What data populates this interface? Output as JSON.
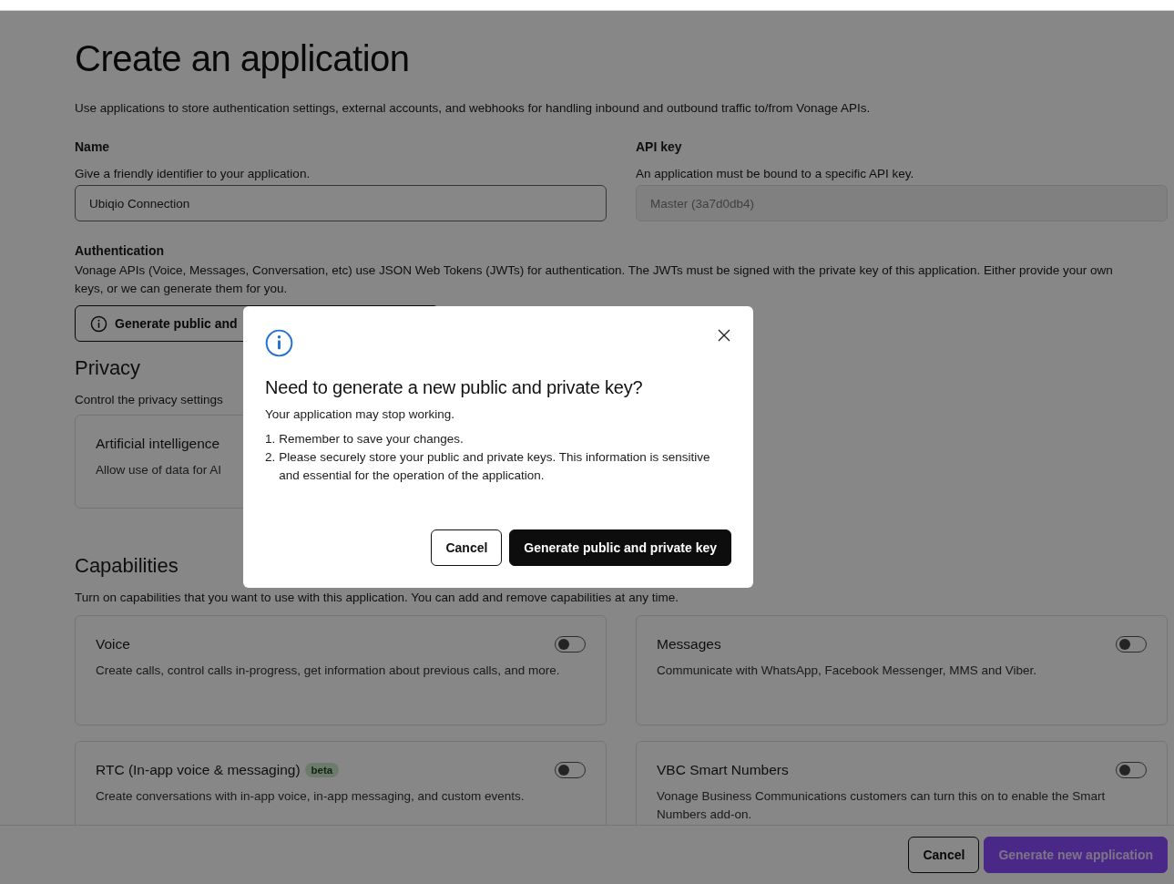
{
  "page": {
    "title": "Create an application",
    "description": "Use applications to store authentication settings, external accounts, and webhooks for handling inbound and outbound traffic to/from Vonage APIs."
  },
  "name_field": {
    "label": "Name",
    "hint": "Give a friendly identifier to your application.",
    "value": "Ubiqio Connection",
    "disabled": false
  },
  "api_key_field": {
    "label": "API key",
    "hint": "An application must be bound to a specific API key.",
    "value": "Master (3a7d0db4)",
    "disabled": true
  },
  "authentication": {
    "label": "Authentication",
    "description": "Vonage APIs (Voice, Messages, Conversation, etc) use JSON Web Tokens (JWTs) for authentication. The JWTs must be signed with the private key of this application. Either provide your own keys, or we can generate them for you.",
    "button": "Generate public and"
  },
  "privacy": {
    "title": "Privacy",
    "description": "Control the privacy settings",
    "card": {
      "title": "Artificial intelligence",
      "description": "Allow use of data for AI"
    }
  },
  "capabilities": {
    "title": "Capabilities",
    "description": "Turn on capabilities that you want to use with this application. You can add and remove capabilities at any time.",
    "items": [
      {
        "title": "Voice",
        "description": "Create calls, control calls in-progress, get information about previous calls, and more.",
        "on": false
      },
      {
        "title": "Messages",
        "description": "Communicate with WhatsApp, Facebook Messenger, MMS and Viber.",
        "on": false
      },
      {
        "title": "RTC (In-app voice & messaging)",
        "badge": "beta",
        "description": "Create conversations with in-app voice, in-app messaging, and custom events.",
        "on": false
      },
      {
        "title": "VBC Smart Numbers",
        "description": "Vonage Business Communications customers can turn this on to enable the Smart Numbers add-on.",
        "on": false
      }
    ]
  },
  "footer": {
    "buttons": [
      {
        "label": "Cancel",
        "kind": "secondary"
      },
      {
        "label": "Generate new application",
        "kind": "primary"
      }
    ]
  },
  "dialog": {
    "title": "Need to generate a new public and private key?",
    "message": "Your application may stop working.",
    "steps": [
      {
        "number": "1.",
        "text": "Remember to save your changes."
      },
      {
        "number": "2.",
        "text": "Please securely store your public and private keys. This information is sensitive and essential for the operation of the application."
      }
    ],
    "buttons": [
      {
        "label": "Cancel",
        "kind": "secondary"
      },
      {
        "label": "Generate public and private key",
        "kind": "primary"
      }
    ]
  }
}
